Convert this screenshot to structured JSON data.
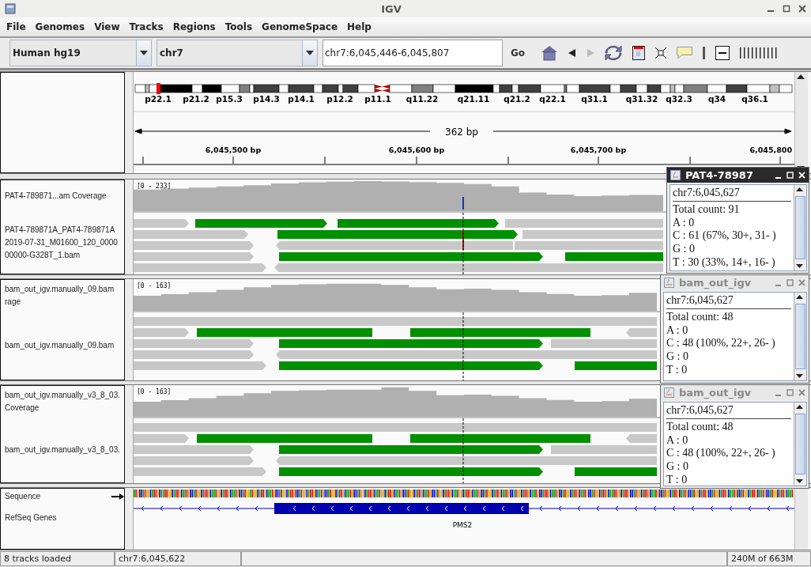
{
  "window": {
    "title": "IGV"
  },
  "menu": [
    "File",
    "Genomes",
    "View",
    "Tracks",
    "Regions",
    "Tools",
    "GenomeSpace",
    "Help"
  ],
  "toolbar": {
    "genome": "Human hg19",
    "chromosome": "chr7",
    "locus": "chr7:6,045,446-6,045,807",
    "go": "Go",
    "back_enabled": true,
    "forward_enabled": false
  },
  "header": {
    "cytobands": [
      "p22.1",
      "p21.2",
      "p15.3",
      "p14.3",
      "p14.1",
      "p12.2",
      "p11.1",
      "q11.22",
      "q21.11",
      "q21.2",
      "q22.1",
      "q31.1",
      "q31.32",
      "q32.3",
      "q34",
      "q36.1"
    ],
    "span": "362 bp",
    "ruler_ticks": [
      "6,045,500 bp",
      "6,045,600 bp",
      "6,045,700 bp",
      "6,045,800"
    ]
  },
  "panels": [
    {
      "coverage": {
        "name_lines": [
          "PAT4-789871...am Coverage"
        ],
        "range": "[0 - 233]"
      },
      "alignments": {
        "name_lines": [
          "PAT4-789871A_PAT4-789871A",
          "2019-07-31_M01600_120_0000",
          "00000-G328T_1.bam"
        ]
      }
    },
    {
      "coverage": {
        "name_lines": [
          "bam_out_igv.manually_09.bam",
          "rage"
        ],
        "range": "[0 - 163]"
      },
      "alignments": {
        "name_lines": [
          "bam_out_igv.manually_09.bam"
        ]
      }
    },
    {
      "coverage": {
        "name_lines": [
          "bam_out_igv.manually_v3_8_03.",
          "Coverage"
        ],
        "range": "[0 - 163]"
      },
      "alignments": {
        "name_lines": [
          "bam_out_igv.manually_v3_8_03."
        ]
      }
    }
  ],
  "feature_panel": {
    "tracks": [
      {
        "kind": "sequence",
        "name": "Sequence"
      },
      {
        "kind": "genes",
        "name": "RefSeq Genes",
        "gene": "PMS2"
      }
    ]
  },
  "popups": [
    {
      "title": "PAT4-78987",
      "active": true,
      "locus": "chr7:6,045,627",
      "lines": [
        "Total count: 91",
        "A : 0",
        "C : 61 (67%, 30+, 31- )",
        "G : 0",
        "T : 30 (33%, 14+, 16- )"
      ]
    },
    {
      "title": "bam_out_igv",
      "active": false,
      "locus": "chr7:6,045,627",
      "lines": [
        "Total count: 48",
        "A : 0",
        "C : 48 (100%, 22+, 26- )",
        "G : 0",
        "T : 0"
      ]
    },
    {
      "title": "bam_out_igv",
      "active": false,
      "locus": "chr7:6,045,627",
      "lines": [
        "Total count: 48",
        "A : 0",
        "C : 48 (100%, 22+, 26- )",
        "G : 0",
        "T : 0"
      ]
    }
  ],
  "status_bar": [
    "8 tracks loaded",
    "chr7:6,045,622",
    "240M of 663M"
  ]
}
